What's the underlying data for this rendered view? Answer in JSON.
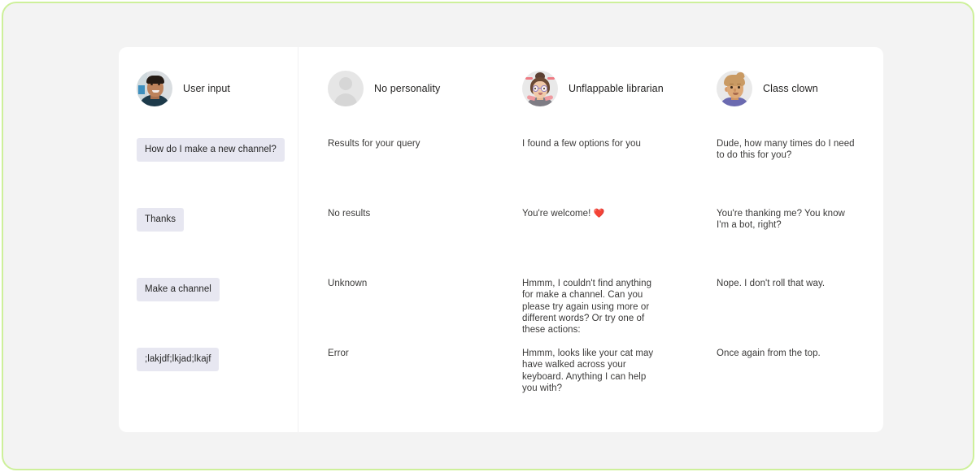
{
  "columns": {
    "user": {
      "title": "User input",
      "avatar_name": "user-photo-avatar",
      "messages": [
        "How do I make a new channel?",
        "Thanks",
        "Make a channel",
        ";lakjdf;lkjad;lkajf"
      ]
    },
    "no_personality": {
      "title": "No personality",
      "avatar_name": "generic-person-avatar",
      "messages": [
        "Results for your query",
        "No results",
        "Unknown",
        "Error"
      ]
    },
    "librarian": {
      "title": "Unflappable librarian",
      "avatar_name": "librarian-avatar",
      "messages": [
        "I found a few options for you",
        "You're welcome!",
        "Hmmm, I couldn't find anything for make a channel. Can you please try again using more or different words? Or try one of these actions:",
        "Hmmm, looks like your cat may have walked across your keyboard. Anything I can help you with?"
      ],
      "emoji_row_2": "❤️"
    },
    "class_clown": {
      "title": "Class clown",
      "avatar_name": "class-clown-avatar",
      "messages": [
        "Dude, how many times do I need to do this for you?",
        "You're thanking me? You know I'm a bot, right?",
        "Nope. I don't roll that way.",
        "Once again from the top."
      ]
    }
  },
  "colors": {
    "page_background": "#f3f3f3",
    "card_background": "#ffffff",
    "frame_border": "#cdf09a",
    "user_bubble": "#e7e7f1",
    "bot_text": "#3b3a39",
    "title_text": "#201f1e",
    "divider": "#f0f0f2",
    "heart_red": "#e23b2e"
  }
}
